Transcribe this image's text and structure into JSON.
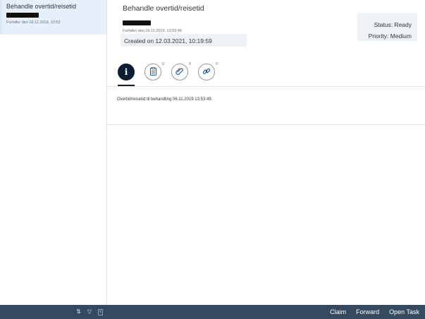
{
  "master": {
    "item": {
      "title": "Behandle overtid/reisetid",
      "due": "Forfaller den 16.11.2019, 13:53"
    },
    "footer": {
      "sort_icon": "sort-icon",
      "filter_icon": "filter-icon",
      "group_icon": "group-icon"
    }
  },
  "detail": {
    "title": "Behandle overtid/reisetid",
    "due": "Forfaller den 16.11.2019, 13:53:49",
    "created": "Created on 12.03.2021, 10:19:59",
    "status": "Status: Ready",
    "priority": "Priority: Medium",
    "tabs": [
      {
        "name": "info",
        "icon": "info-icon",
        "glyph": "i"
      },
      {
        "name": "notes",
        "icon": "clipboard-icon",
        "glyph": "📋",
        "count": "0"
      },
      {
        "name": "attachments",
        "icon": "paperclip-icon",
        "glyph": "📎",
        "count": "0"
      },
      {
        "name": "links",
        "icon": "link-icon",
        "glyph": "🔗",
        "count": "0"
      }
    ],
    "description": "Overtid/reisetid til behandling 06.11.2019 13:53:49."
  },
  "footer": {
    "claim": "Claim",
    "forward": "Forward",
    "open_task": "Open Task"
  },
  "colors": {
    "shell_bar": "#354a5f",
    "selected_item": "#e5f0fa",
    "active_tab": "#0a1f33",
    "panel_bg": "#edf2f7"
  }
}
